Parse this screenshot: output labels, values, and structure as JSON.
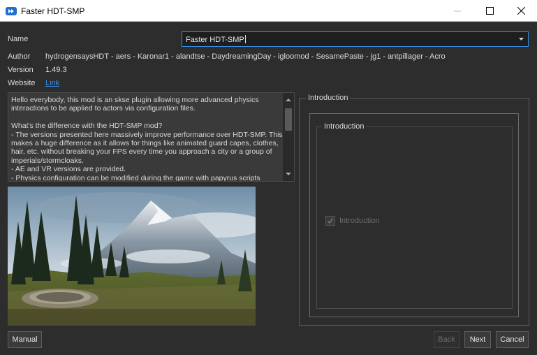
{
  "window": {
    "title": "Faster HDT-SMP",
    "icon": "mo2-app-icon"
  },
  "labels": {
    "name": "Name",
    "author": "Author",
    "version": "Version",
    "website": "Website"
  },
  "name_value": "Faster HDT-SMP",
  "author_value": "hydrogensaysHDT - aers - Karonar1 - alandtse - DaydreamingDay - igloomod - SesamePaste - jg1 - antpillager - Acro",
  "version_value": "1.49.3",
  "website_link": "Link",
  "description": "Hello everybody, this mod is an skse plugin allowing more advanced physics interactions to be applied to actors via configuration files.\n\nWhat's the difference with the HDT-SMP mod?\n- The versions presented here massively improve performance over HDT-SMP. This makes a huge difference as it allows for things like animated guard capes, clothes, hair, etc. without breaking your FPS every time you approach a city or a group of imperials/stormcloaks.\n- AE and VR versions are provided.\n- Physics configuration can be modified during the game with papyrus scripts",
  "right_panel": {
    "title": "Introduction",
    "group_title": "Introduction",
    "option_label": "Introduction",
    "option_checked": true,
    "option_enabled": false
  },
  "buttons": {
    "manual": "Manual",
    "back": "Back",
    "next": "Next",
    "cancel": "Cancel"
  }
}
